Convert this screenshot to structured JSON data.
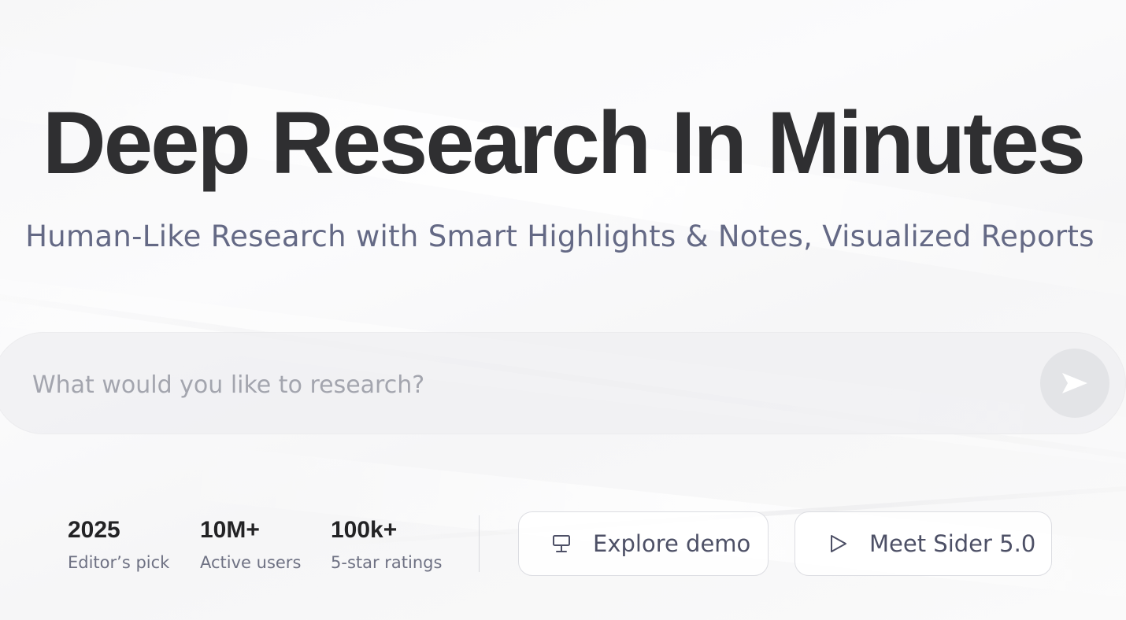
{
  "hero": {
    "title": "Deep Research In Minutes",
    "subtitle": "Human-Like Research with Smart Highlights & Notes, Visualized Reports"
  },
  "search": {
    "value": "",
    "placeholder": "What would you like to research?",
    "send_icon": "send-icon"
  },
  "stats": [
    {
      "value": "2025",
      "label": "Editor’s pick"
    },
    {
      "value": "10M+",
      "label": "Active users"
    },
    {
      "value": "100k+",
      "label": "5-star ratings"
    }
  ],
  "actions": {
    "explore_demo": {
      "label": "Explore demo",
      "icon": "monitor-icon"
    },
    "meet_sider": {
      "label": "Meet Sider 5.0",
      "icon": "play-icon"
    }
  },
  "colors": {
    "title": "#2f2f31",
    "subtitle": "#646985",
    "placeholder": "#a3a5ae",
    "button_text": "#4d5066",
    "send_button_bg": "#e3e4e7"
  }
}
